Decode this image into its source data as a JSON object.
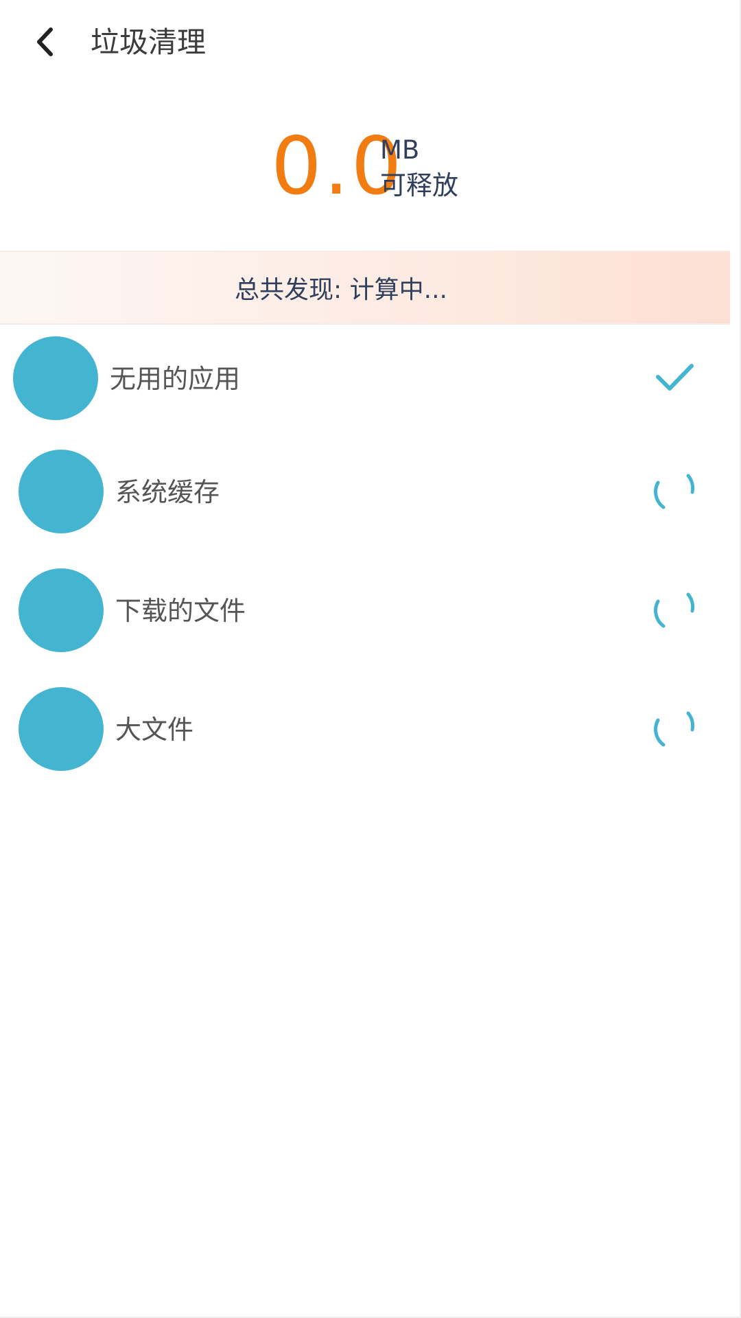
{
  "header": {
    "title": "垃圾清理",
    "back_icon": "chevron-left-icon"
  },
  "summary": {
    "size_value": "0.0",
    "size_unit": "MB",
    "caption": "可释放",
    "accent_color": "#f07c12"
  },
  "banner": {
    "text": "总共发现: 计算中..."
  },
  "items": [
    {
      "label": "无用的应用",
      "status": "done",
      "status_icon": "checkmark-icon"
    },
    {
      "label": "系统缓存",
      "status": "scanning",
      "status_icon": "loading-spinner-icon"
    },
    {
      "label": "下载的文件",
      "status": "scanning",
      "status_icon": "loading-spinner-icon"
    },
    {
      "label": "大文件",
      "status": "scanning",
      "status_icon": "loading-spinner-icon"
    }
  ],
  "colors": {
    "item_icon": "#43b5d0",
    "title_text": "#2f3f5c"
  }
}
